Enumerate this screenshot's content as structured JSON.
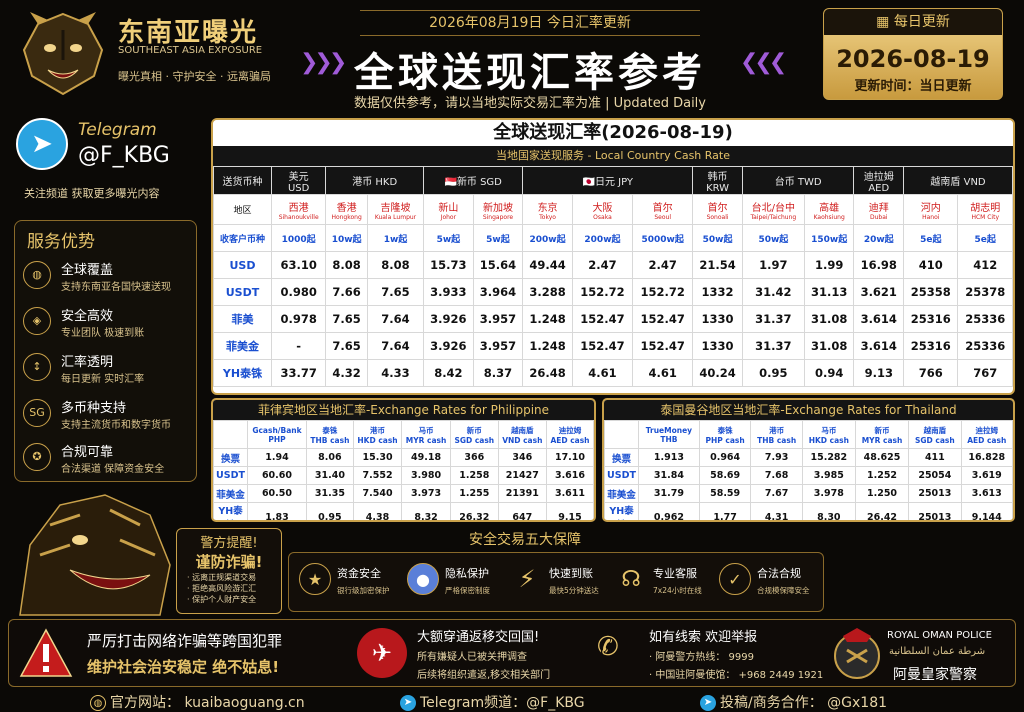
{
  "brand": {
    "name_cn": "东南亚曝光",
    "name_en": "SOUTHEAST ASIA EXPOSURE",
    "slogan": "曝光真相 · 守护安全 · 远离骗局",
    "logo_icon": "tiger-head-icon"
  },
  "header": {
    "top_date": "2026年08月19日 今日汇率更新",
    "title": "全球送现汇率参考",
    "subtitle": "数据仅供参考，请以当地实际交易汇率为准 | Updated Daily"
  },
  "date_box": {
    "label": "每日更新",
    "date": "2026-08-19",
    "update_time": "更新时间：当日更新",
    "icon": "calendar-icon"
  },
  "telegram": {
    "label": "Telegram",
    "handle": "@F_KBG",
    "note": "关注频道  获取更多曝光内容",
    "icon": "telegram-icon"
  },
  "advantages": {
    "title": "服务优势",
    "items": [
      {
        "title": "全球覆盖",
        "desc": "支持东南亚各国快速送现",
        "icon": "globe-icon"
      },
      {
        "title": "安全高效",
        "desc": "专业团队  极速到账",
        "icon": "shield-icon"
      },
      {
        "title": "汇率透明",
        "desc": "每日更新  实时汇率",
        "icon": "chart-icon"
      },
      {
        "title": "多币种支持",
        "desc": "支持主流货币和数字货币",
        "icon": "coin-icon"
      },
      {
        "title": "合规可靠",
        "desc": "合法渠道  保障资金安全",
        "icon": "badge-icon"
      }
    ]
  },
  "rate_table": {
    "title": "全球送现汇率(2026-08-19)",
    "subtitle": "当地国家送现服务 - Local Country Cash Rate",
    "corner": "送货币种",
    "currencies": [
      {
        "label": "美元\nUSD",
        "span": 1
      },
      {
        "label": "港币  HKD",
        "span": 2
      },
      {
        "label": "🇸🇬新币  SGD",
        "span": 2
      },
      {
        "label": "🇯🇵日元  JPY",
        "span": 3
      },
      {
        "label": "韩币\nKRW",
        "span": 1
      },
      {
        "label": "台币  TWD",
        "span": 2
      },
      {
        "label": "迪拉姆\nAED",
        "span": 1
      },
      {
        "label": "越南盾  VND",
        "span": 2
      }
    ],
    "area_label": "地区",
    "cities": [
      {
        "cn": "西港",
        "en": "Sihanoukville"
      },
      {
        "cn": "香港",
        "en": "Hongkong"
      },
      {
        "cn": "吉隆坡",
        "en": "Kuala Lumpur"
      },
      {
        "cn": "新山",
        "en": "Johor"
      },
      {
        "cn": "新加坡",
        "en": "Singapore"
      },
      {
        "cn": "东京",
        "en": "Tokyo"
      },
      {
        "cn": "大阪",
        "en": "Osaka"
      },
      {
        "cn": "首尔",
        "en": "Seoul"
      },
      {
        "cn": "首尔",
        "en": "Sonoali"
      },
      {
        "cn": "台北/台中",
        "en": "Taipei/Taichung"
      },
      {
        "cn": "高雄",
        "en": "Kaohsiung"
      },
      {
        "cn": "迪拜",
        "en": "Dubai"
      },
      {
        "cn": "河内",
        "en": "Hanoi"
      },
      {
        "cn": "胡志明",
        "en": "HCM City"
      }
    ],
    "min_label": "收客户币种",
    "mins": [
      "1000起",
      "10w起",
      "1w起",
      "5w起",
      "5w起",
      "200w起",
      "200w起",
      "5000w起",
      "50w起",
      "50w起",
      "150w起",
      "20w起",
      "5e起",
      "5e起"
    ],
    "rows": [
      {
        "label": "USD",
        "values": [
          "63.10",
          "8.08",
          "8.08",
          "15.73",
          "15.64",
          "49.44",
          "2.47",
          "2.47",
          "21.54",
          "1.97",
          "1.99",
          "16.98",
          "410",
          "412"
        ]
      },
      {
        "label": "USDT",
        "values": [
          "0.980",
          "7.66",
          "7.65",
          "3.933",
          "3.964",
          "3.288",
          "152.72",
          "152.72",
          "1332",
          "31.42",
          "31.13",
          "3.621",
          "25358",
          "25378"
        ]
      },
      {
        "label": "菲美",
        "values": [
          "0.978",
          "7.65",
          "7.64",
          "3.926",
          "3.957",
          "1.248",
          "152.47",
          "152.47",
          "1330",
          "31.37",
          "31.08",
          "3.614",
          "25316",
          "25336"
        ]
      },
      {
        "label": "菲美金",
        "values": [
          "-",
          "7.65",
          "7.64",
          "3.926",
          "3.957",
          "1.248",
          "152.47",
          "152.47",
          "1330",
          "31.37",
          "31.08",
          "3.614",
          "25316",
          "25336"
        ]
      },
      {
        "label": "YH泰铢",
        "values": [
          "33.77",
          "4.32",
          "4.33",
          "8.42",
          "8.37",
          "26.48",
          "4.61",
          "4.61",
          "40.24",
          "0.95",
          "0.94",
          "9.13",
          "766",
          "767"
        ]
      }
    ]
  },
  "ph_table": {
    "title": "菲律宾地区当地汇率-Exchange Rates for Philippine",
    "headers": [
      "Gcash/Bank\nPHP",
      "泰铢\nTHB cash",
      "港币\nHKD cash",
      "马币\nMYR cash",
      "新币\nSGD cash",
      "越南盾\nVND cash",
      "迪拉姆\nAED cash"
    ],
    "rows": [
      {
        "label": "换票",
        "values": [
          "1.94",
          "8.06",
          "15.30",
          "49.18",
          "366",
          "346",
          "17.10"
        ]
      },
      {
        "label": "USDT",
        "values": [
          "60.60",
          "31.40",
          "7.552",
          "3.980",
          "1.258",
          "21427",
          "3.616"
        ]
      },
      {
        "label": "菲美金",
        "values": [
          "60.50",
          "31.35",
          "7.540",
          "3.973",
          "1.255",
          "21391",
          "3.611"
        ]
      },
      {
        "label": "YH泰铢",
        "values": [
          "1.83",
          "0.95",
          "4.38",
          "8.32",
          "26.32",
          "647",
          "9.15"
        ]
      }
    ]
  },
  "th_table": {
    "title": "泰国曼谷地区当地汇率-Exchange Rates for Thailand",
    "headers": [
      "TrueMoney\nTHB",
      "泰铢\nPHP cash",
      "港币\nTHB cash",
      "马币\nHKD cash",
      "新币\nMYR cash",
      "越南盾\nSGD cash",
      "迪拉姆\nAED cash"
    ],
    "rows": [
      {
        "label": "换票",
        "values": [
          "1.913",
          "0.964",
          "7.93",
          "15.282",
          "48.625",
          "411",
          "16.828"
        ]
      },
      {
        "label": "USDT",
        "values": [
          "31.84",
          "58.69",
          "7.68",
          "3.985",
          "1.252",
          "25054",
          "3.619"
        ]
      },
      {
        "label": "菲美金",
        "values": [
          "31.79",
          "58.59",
          "7.67",
          "3.978",
          "1.250",
          "25013",
          "3.613"
        ]
      },
      {
        "label": "YH泰铢",
        "values": [
          "0.962",
          "1.77",
          "4.31",
          "8.30",
          "26.42",
          "25013",
          "9.144"
        ]
      }
    ]
  },
  "warning": {
    "line1": "警方提醒!",
    "line2": "谨防诈骗!",
    "items": [
      "· 远离正规渠道交易",
      "· 拒绝高风险游汇汇",
      "· 保护个人财产安全"
    ]
  },
  "guarantees": {
    "title": "安全交易五大保障",
    "items": [
      {
        "title": "资金安全",
        "desc": "银行级加密保护",
        "icon": "shield-star-icon"
      },
      {
        "title": "隐私保护",
        "desc": "严格保密制度",
        "icon": "person-lock-icon"
      },
      {
        "title": "快速到账",
        "desc": "最快5分钟送达",
        "icon": "lightning-icon"
      },
      {
        "title": "专业客服",
        "desc": "7x24小时在线",
        "icon": "headset-icon"
      },
      {
        "title": "合法合规",
        "desc": "合规模保障安全",
        "icon": "checkmark-icon"
      }
    ]
  },
  "bottom": {
    "alert_line1": "严厉打击网络诈骗等跨国犯罪",
    "alert_line2": "维护社会治安稳定  绝不姑息!",
    "return_title": "大额穿通返移交回国!",
    "return_line1": "所有嫌疑人已被关押调查",
    "return_line2": "后续将组织遣返,移交相关部门",
    "tip_title": "如有线索    欢迎举报",
    "tip_line1": "· 阿曼警方热线：  9999",
    "tip_line2": "· 中国驻阿曼使馆：  +968 2449 1921",
    "police_en": "ROYAL OMAN POLICE",
    "police_ar": "شرطة عمان السلطانية",
    "police_cn": "阿曼皇家警察"
  },
  "footer": {
    "website": "官方网站： kuaibaoguang.cn",
    "telegram": "Telegram频道：@F_KBG",
    "contact": "投稿/商务合作： @Gx181"
  },
  "colors": {
    "gold": "#e6c36a",
    "background": "#0b0906",
    "link_blue": "#1a4fd0",
    "city_red": "#d01c1c"
  }
}
